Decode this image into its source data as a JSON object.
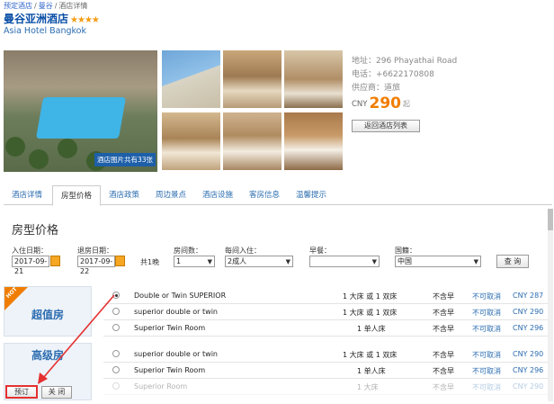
{
  "breadcrumb": {
    "items": [
      "预定酒店",
      "曼谷",
      "酒店详情"
    ],
    "sep": "/"
  },
  "hotel": {
    "name": "曼谷亚洲酒店",
    "stars": "★★★★",
    "name_en": "Asia Hotel Bangkok"
  },
  "gallery": {
    "photo_count": "酒店图片共有33张"
  },
  "info": {
    "address": "地址：296 Phayathai Road",
    "phone": "电话：+6622170808",
    "supplier": "供应商：道旅",
    "currency": "CNY",
    "price": "290",
    "price_suffix": "起",
    "back_button": "返回酒店列表"
  },
  "tabs": [
    "酒店详情",
    "房型价格",
    "酒店政策",
    "周边景点",
    "酒店设施",
    "客房信息",
    "温馨提示"
  ],
  "section_title": "房型价格",
  "filters": {
    "checkin_label": "入住日期：",
    "checkin_value": "2017-09-21",
    "checkout_label": "退房日期：",
    "checkout_value": "2017-09-22",
    "nights": "共1晚",
    "rooms_label": "房间数：",
    "rooms_value": "1",
    "guests_label": "每间入住：",
    "guests_value": "2成人",
    "breakfast_label": "早餐：",
    "breakfast_value": "",
    "country_label": "国籍：",
    "country_value": "中国",
    "query_button": "查 询"
  },
  "groups": [
    {
      "label": "超值房",
      "hot": "HOT"
    },
    {
      "label": "高级房"
    }
  ],
  "rooms": [
    {
      "name": "Double or Twin SUPERIOR",
      "bed": "1 大床 或 1 双床",
      "meal": "不含早",
      "cancel": "不可取消",
      "price": "CNY 287",
      "selected": true
    },
    {
      "name": "superior double or twin",
      "bed": "1 大床 或 1 双床",
      "meal": "不含早",
      "cancel": "不可取消",
      "price": "CNY 290"
    },
    {
      "name": "Superior Twin Room",
      "bed": "1 单人床",
      "meal": "不含早",
      "cancel": "不可取消",
      "price": "CNY 296"
    },
    {
      "name": "superior double or twin",
      "bed": "1 大床 或 1 双床",
      "meal": "不含早",
      "cancel": "不可取消",
      "price": "CNY 290"
    },
    {
      "name": "Superior Twin Room",
      "bed": "1 单人床",
      "meal": "不含早",
      "cancel": "不可取消",
      "price": "CNY 296"
    },
    {
      "name": "Superior Room",
      "bed": "1 大床",
      "meal": "不含早",
      "cancel": "不可取消",
      "price": "CNY 290"
    }
  ],
  "actions": {
    "book": "预订",
    "close": "关 闭"
  }
}
